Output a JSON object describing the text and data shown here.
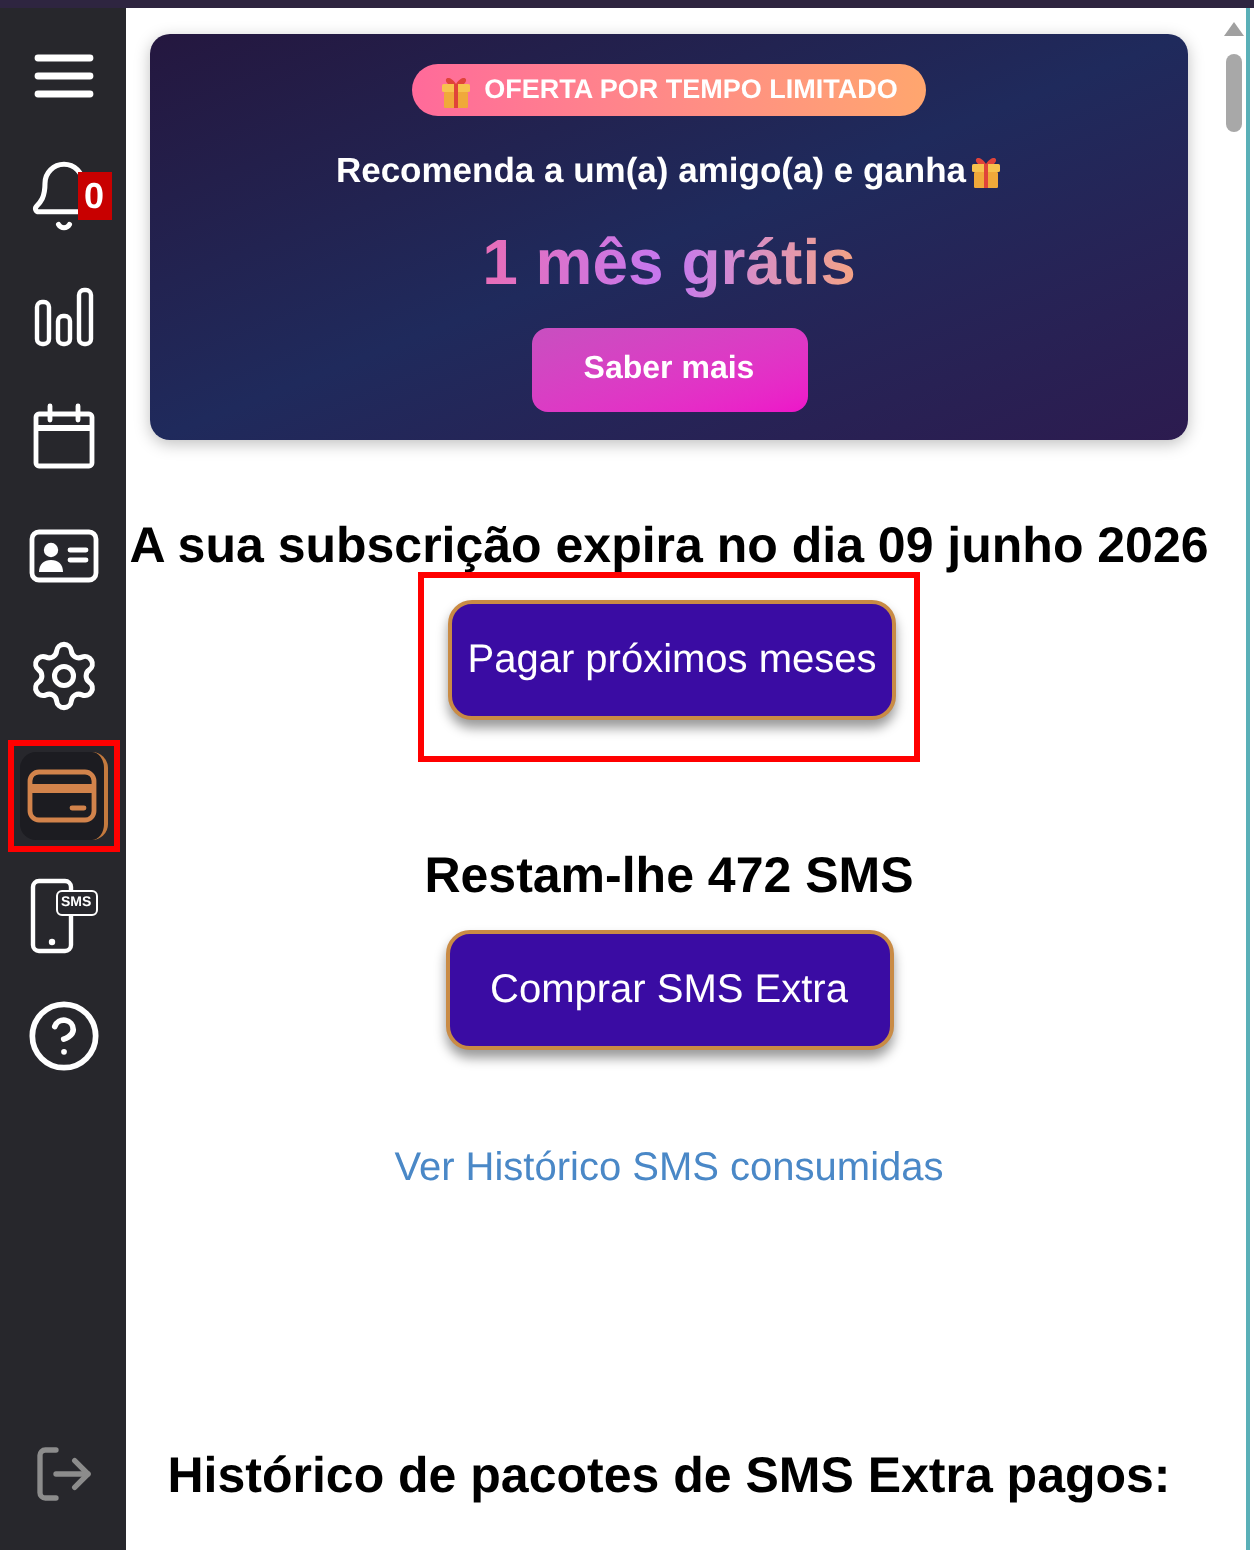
{
  "sidebar": {
    "items": [
      {
        "kind": "menu",
        "selected": false,
        "highlighted": false
      },
      {
        "kind": "notifications",
        "selected": false,
        "highlighted": false,
        "badge": "0"
      },
      {
        "kind": "statistics",
        "selected": false,
        "highlighted": false
      },
      {
        "kind": "calendar",
        "selected": false,
        "highlighted": false
      },
      {
        "kind": "contacts",
        "selected": false,
        "highlighted": false
      },
      {
        "kind": "settings",
        "selected": false,
        "highlighted": false
      },
      {
        "kind": "payments",
        "selected": true,
        "highlighted": true
      },
      {
        "kind": "sms",
        "selected": false,
        "highlighted": false,
        "icon_text": "SMS"
      },
      {
        "kind": "help",
        "selected": false,
        "highlighted": false
      }
    ],
    "footer_items": [
      {
        "kind": "logout"
      }
    ]
  },
  "promo": {
    "badge": "OFERTA POR TEMPO LIMITADO",
    "text": "Recomenda a um(a) amigo(a) e ganha",
    "headline": "1 mês grátis",
    "button": "Saber mais"
  },
  "subscription": {
    "text": "A sua subscrição expira no dia 09 junho 2026",
    "button": {
      "label": "Pagar próximos meses",
      "highlighted": true
    }
  },
  "sms": {
    "text": "Restam-lhe 472 SMS",
    "button": {
      "label": "Comprar SMS Extra",
      "highlighted": false
    },
    "history_link": "Ver Histórico SMS consumidas"
  },
  "packages": {
    "title": "Histórico de pacotes de SMS Extra pagos:"
  }
}
